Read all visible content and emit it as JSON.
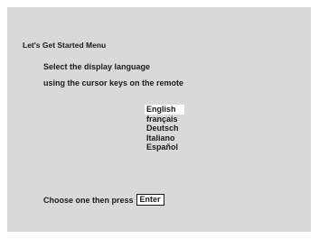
{
  "menu": {
    "title": "Let's Get Started Menu",
    "instruction_line1": "Select the display language",
    "instruction_line2": "using the cursor keys on the remote"
  },
  "languages": [
    {
      "label": "English",
      "selected": true
    },
    {
      "label": "français",
      "selected": false
    },
    {
      "label": "Deutsch",
      "selected": false
    },
    {
      "label": "Italiano",
      "selected": false
    },
    {
      "label": "Español",
      "selected": false
    }
  ],
  "footer": {
    "prompt": "Choose one then press",
    "key_label": "Enter"
  },
  "colors": {
    "panel_background": "#d9d9d9",
    "highlight": "#ffffff",
    "text": "#1a1a1a"
  }
}
